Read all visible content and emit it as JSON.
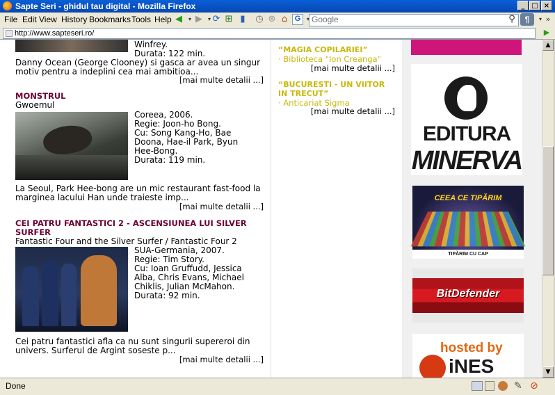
{
  "window": {
    "title": "Sapte Seri - ghidul tau digital - Mozilla Firefox"
  },
  "menu": [
    "File",
    "Edit",
    "View",
    "History",
    "Bookmarks",
    "Tools",
    "Help"
  ],
  "search": {
    "placeholder": "Google",
    "engine_label": "G"
  },
  "address": {
    "url": "http://www.sapteseri.ro/"
  },
  "status": {
    "text": "Done"
  },
  "movies": {
    "top": {
      "line": "Winfrey.",
      "duration": "Durata: 122 min.",
      "desc1": "Danny Ocean (George Clooney) si gasca ar avea un singur",
      "desc2": "motiv pentru a indeplini cea mai ambitioa...",
      "more": "[mai multe detalii ...]"
    },
    "m1": {
      "title": "MONSTRUL",
      "original": "Gwoemul",
      "info": [
        "Coreea, 2006.",
        "Regie: Joon-ho Bong.",
        "Cu: Song Kang-Ho, Bae",
        "Doona, Hae-il Park, Byun",
        "Hee-Bong.",
        "Durata: 119 min."
      ],
      "desc1": "La Seoul, Park Hee-bong are un mic restaurant fast-food la",
      "desc2": "marginea lacului Han unde traieste imp...",
      "more": "[mai multe detalii ...]"
    },
    "m2": {
      "title1": "CEI PATRU FANTASTICI 2 - ASCENSIUNEA LUI SILVER",
      "title2": "SURFER",
      "original": "Fantastic Four and the Silver Surfer / Fantastic Four 2",
      "info": [
        "SUA-Germania, 2007.",
        "Regie: Tim Story.",
        "Cu: Ioan Gruffudd, Jessica",
        "Alba, Chris Evans, Michael",
        "Chiklis, Julian McMahon.",
        "Durata: 92 min."
      ],
      "desc1": "Cei patru fantastici afla ca nu sunt singurii supereroi din",
      "desc2": "univers. Surferul de Argint soseste p...",
      "more": "[mai multe detalii ...]"
    }
  },
  "books": [
    {
      "title": "“MAGIA COPILARIEI”",
      "link": "· Biblioteca \"Ion Creanga\"",
      "more": "[mai multe detalii ...]"
    },
    {
      "title1": "“BUCURESTI - UN VIITOR",
      "title2": "IN TRECUT”",
      "link": "· Anticariat Sigma",
      "more": "[mai multe detalii ...]"
    }
  ],
  "ads": {
    "editura1": "EDITURA",
    "editura2": "MINERVA",
    "ceea1": "CEEA CE TIPĂRIM",
    "ceea2": "TIPĂRIM CU CAP",
    "bitdefender": "BitDefender",
    "hosted": "hosted by",
    "ines": "iNES"
  }
}
